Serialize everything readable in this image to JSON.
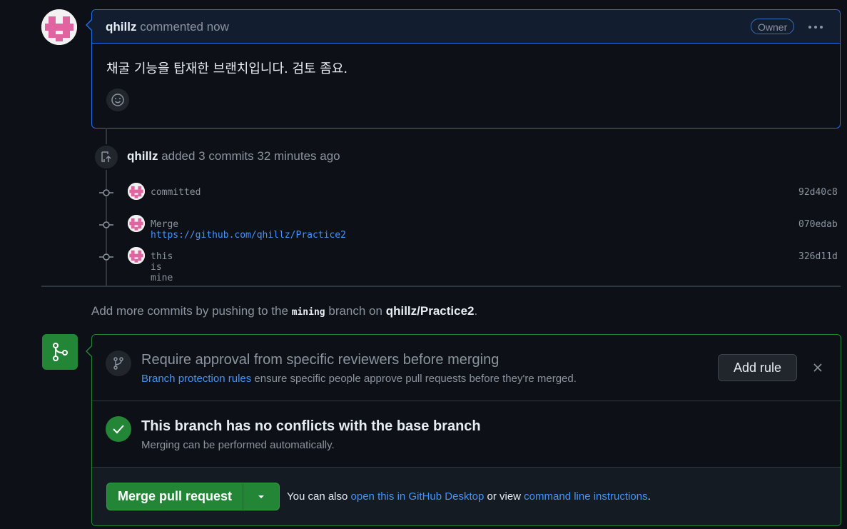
{
  "comment": {
    "author": "qhillz",
    "action": "commented now",
    "badge": "Owner",
    "body": "채굴 기능을 탑재한 브랜치입니다. 검토 좀요."
  },
  "commits_event": {
    "author": "qhillz",
    "action": "added 3 commits 32 minutes ago",
    "commits": [
      {
        "message": "committed",
        "link": "",
        "sha": "92d40c8"
      },
      {
        "message": "Merge",
        "link": "https://github.com/qhillz/Practice2",
        "sha": "070edab"
      },
      {
        "message": "this is mine",
        "link": "",
        "sha": "326d11d"
      }
    ]
  },
  "push_hint": {
    "prefix": "Add more commits by pushing to the",
    "branch": "mining",
    "middle": "branch on",
    "repo": "qhillz/Practice2",
    "suffix": "."
  },
  "merge_box": {
    "protection": {
      "title": "Require approval from specific reviewers before merging",
      "link": "Branch protection rules",
      "desc": "ensure specific people approve pull requests before they're merged.",
      "add_rule_label": "Add rule"
    },
    "status": {
      "title": "This branch has no conflicts with the base branch",
      "desc": "Merging can be performed automatically."
    },
    "footer": {
      "merge_label": "Merge pull request",
      "hint_prefix": "You can also",
      "desktop_link": "open this in GitHub Desktop",
      "hint_middle": "or view",
      "cli_link": "command line instructions",
      "hint_suffix": "."
    }
  },
  "colors": {
    "background": "#0d1117",
    "accent_blue": "#1f6feb",
    "link": "#4493f8",
    "success_green": "#238636",
    "muted": "#8b949e"
  },
  "icons": [
    "avatar-identicon",
    "smiley-icon",
    "repo-push-icon",
    "git-commit-icon",
    "git-merge-icon",
    "git-branch-icon",
    "check-icon",
    "x-icon",
    "triangle-down-icon",
    "kebab-horizontal-icon"
  ]
}
